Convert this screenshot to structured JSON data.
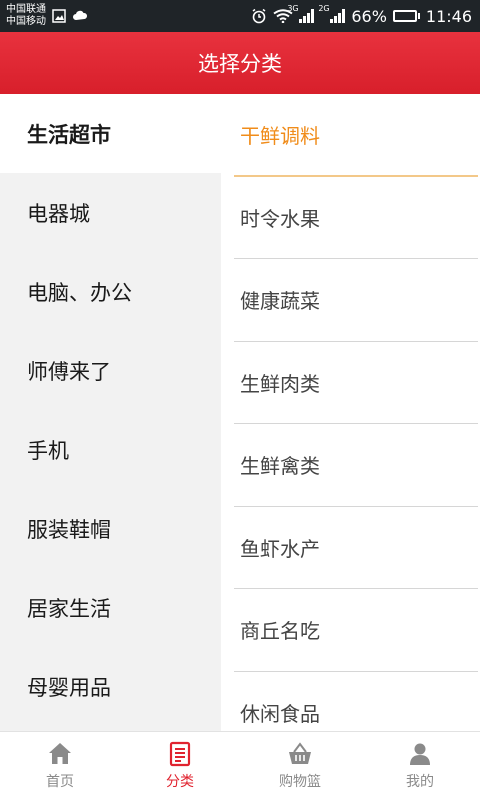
{
  "status_bar": {
    "carrier_1": "中国联通",
    "carrier_2": "中国移动",
    "network_1": "3G",
    "network_2": "2G",
    "battery_percent": "66%",
    "battery_level": 0.66,
    "time": "11:46"
  },
  "header": {
    "title": "选择分类"
  },
  "categories": [
    {
      "label": "生活超市",
      "active": true
    },
    {
      "label": "电器城"
    },
    {
      "label": "电脑、办公"
    },
    {
      "label": "师傅来了"
    },
    {
      "label": "手机"
    },
    {
      "label": "服装鞋帽"
    },
    {
      "label": "居家生活"
    },
    {
      "label": "母婴用品"
    }
  ],
  "subcategories": [
    {
      "label": "干鲜调料",
      "active": true
    },
    {
      "label": "时令水果"
    },
    {
      "label": "健康蔬菜"
    },
    {
      "label": "生鲜肉类"
    },
    {
      "label": "生鲜禽类"
    },
    {
      "label": "鱼虾水产"
    },
    {
      "label": "商丘名吃"
    },
    {
      "label": "休闲食品"
    }
  ],
  "tabs": [
    {
      "label": "首页",
      "icon": "home-icon"
    },
    {
      "label": "分类",
      "icon": "category-list-icon",
      "active": true
    },
    {
      "label": "购物篮",
      "icon": "basket-icon"
    },
    {
      "label": "我的",
      "icon": "user-icon"
    }
  ],
  "colors": {
    "header_red": "#e0232f",
    "active_orange": "#f08c1a",
    "tab_active": "#e0232f",
    "tab_inactive": "#8a8a8a"
  }
}
